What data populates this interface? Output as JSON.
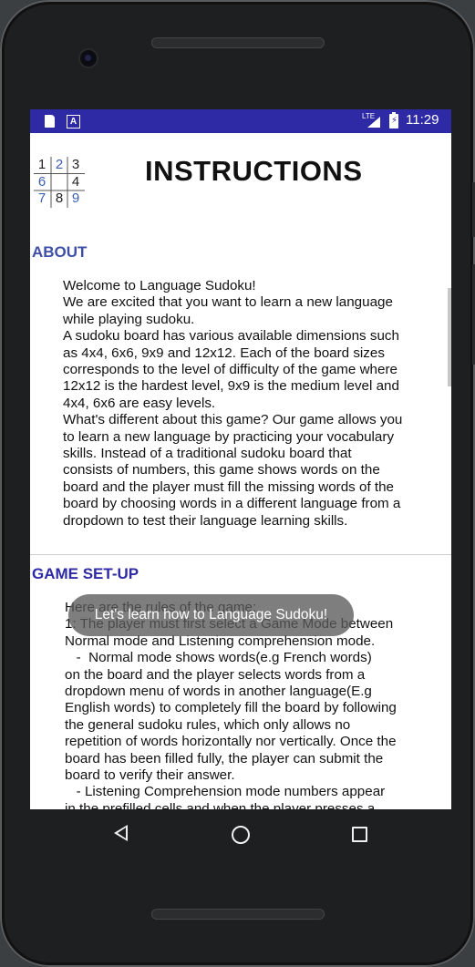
{
  "status_bar": {
    "network": "LTE",
    "time": "11:29",
    "icons": [
      "sd-card-icon",
      "a-letter-icon",
      "signal-icon",
      "battery-charging-icon"
    ],
    "color": "#2e2aa6"
  },
  "logo": {
    "cells": [
      "1",
      "2",
      "3",
      "6",
      "",
      "4",
      "7",
      "8",
      "9"
    ]
  },
  "header": {
    "title": "INSTRUCTIONS"
  },
  "about": {
    "heading": "ABOUT",
    "heading_color": "#3f4fa8",
    "text": "Welcome to Language Sudoku!\nWe are excited that you want to learn a new language\nwhile playing sudoku.\nA sudoku board has various available dimensions such\nas 4x4, 6x6, 9x9 and 12x12. Each of the board sizes\ncorresponds to the level of difficulty of the game where\n12x12 is the hardest level, 9x9 is the medium level and\n4x4, 6x6 are easy levels.\nWhat's different about this game? Our game allows you\nto learn a new language by practicing your vocabulary\nskills. Instead of a traditional sudoku board that\nconsists of numbers, this game shows words on the\nboard and the player must fill the missing words of the\nboard by choosing words in a different language from a\ndropdown to test their language learning skills."
  },
  "setup": {
    "heading": "GAME SET-UP",
    "heading_color": "#2e2aa6",
    "text": "Here are the rules of the game:\n1: The player must first select a Game Mode between\nNormal mode and Listening comprehension mode.\n   -  Normal mode shows words(e.g French words)\non the board and the player selects words from a\ndropdown menu of words in another language(E.g\nEnglish words) to completely fill the board by following\nthe general sudoku rules, which only allows no\nrepetition of words horizontally nor vertically. Once the\nboard has been filled fully, the player can submit the\nboard to verify their answer.\n   - Listening Comprehension mode numbers appear\nin the prefilled cells and when the player presses a"
  },
  "toast": {
    "message": "Let's learn how to Language Sudoku!"
  },
  "nav": {
    "back": "back-icon",
    "home": "home-icon",
    "recents": "recents-icon"
  }
}
